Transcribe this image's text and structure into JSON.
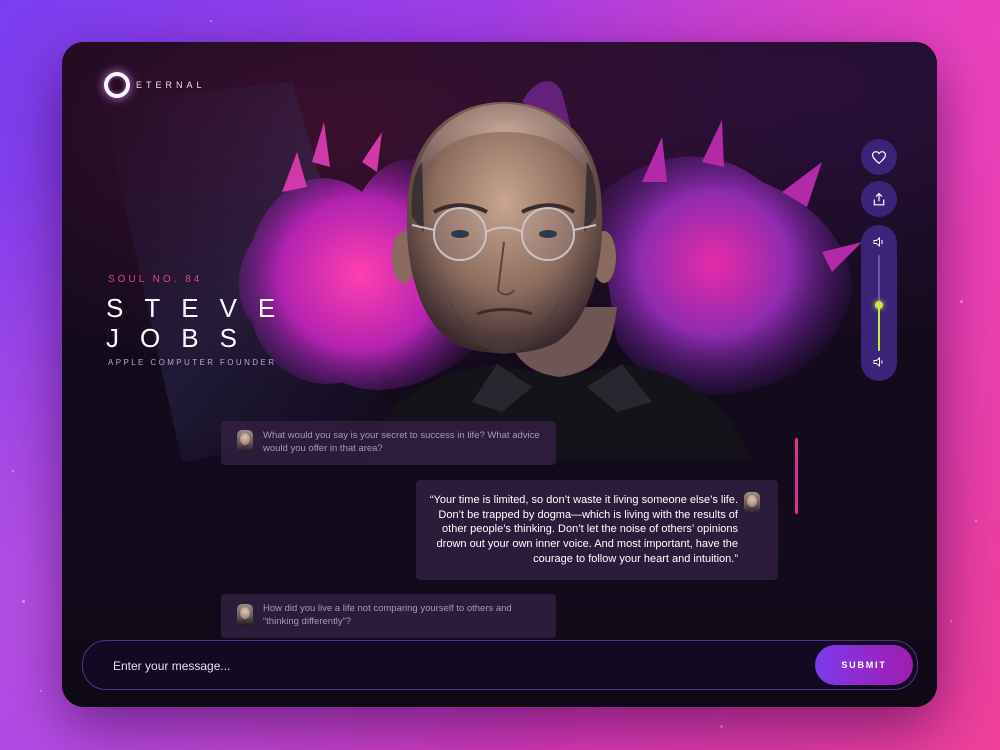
{
  "brand": {
    "name": "ETERNAL"
  },
  "profile": {
    "soul_number": "SOUL NO. 84",
    "first_name": "STEVE",
    "last_name": "JOBS",
    "subtitle": "APPLE COMPUTER FOUNDER"
  },
  "controls": {
    "like_icon": "heart-icon",
    "share_icon": "share-icon",
    "volume_up_icon": "volume-icon",
    "volume_down_icon": "volume-low-icon",
    "volume_level": 0.48,
    "accent_color": "#c4ec3c"
  },
  "chat": {
    "messages": [
      {
        "role": "user",
        "text": "What would you say is your secret to success in life? What advice would you offer in that area?"
      },
      {
        "role": "soul",
        "text": "“Your time is limited, so don’t waste it living someone else’s life. Don’t be trapped by dogma—which is living with the results of other people’s thinking. Don’t let the noise of others’ opinions drown out your own inner voice. And most important, have the courage to follow your heart and intuition.”"
      },
      {
        "role": "user",
        "text": "How did you live a life not comparing yourself to others and “thinking differently”?"
      }
    ]
  },
  "composer": {
    "placeholder": "Enter your message...",
    "submit_label": "SUBMIT"
  },
  "colors": {
    "background_start": "#7a3ef0",
    "background_end": "#f0409a",
    "accent_pink": "#d94a86",
    "button_purple": "#3b2378"
  }
}
